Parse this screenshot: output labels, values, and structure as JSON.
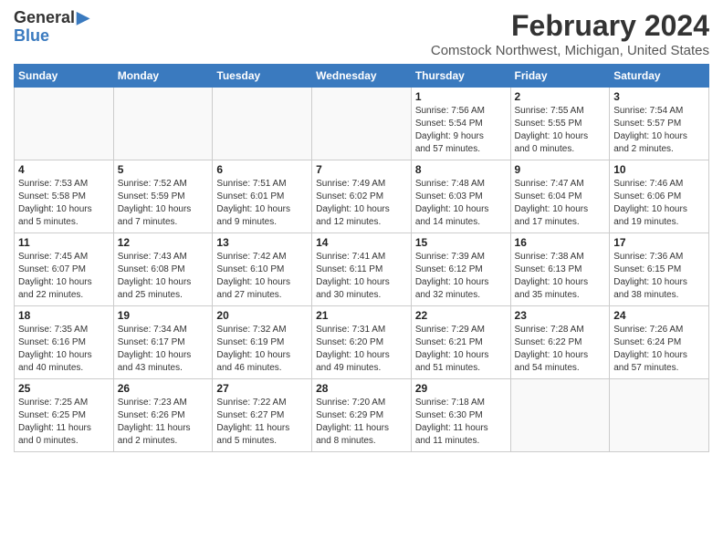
{
  "logo": {
    "general": "General",
    "blue": "Blue"
  },
  "title": "February 2024",
  "subtitle": "Comstock Northwest, Michigan, United States",
  "days_of_week": [
    "Sunday",
    "Monday",
    "Tuesday",
    "Wednesday",
    "Thursday",
    "Friday",
    "Saturday"
  ],
  "weeks": [
    [
      {
        "day": "",
        "info": ""
      },
      {
        "day": "",
        "info": ""
      },
      {
        "day": "",
        "info": ""
      },
      {
        "day": "",
        "info": ""
      },
      {
        "day": "1",
        "info": "Sunrise: 7:56 AM\nSunset: 5:54 PM\nDaylight: 9 hours\nand 57 minutes."
      },
      {
        "day": "2",
        "info": "Sunrise: 7:55 AM\nSunset: 5:55 PM\nDaylight: 10 hours\nand 0 minutes."
      },
      {
        "day": "3",
        "info": "Sunrise: 7:54 AM\nSunset: 5:57 PM\nDaylight: 10 hours\nand 2 minutes."
      }
    ],
    [
      {
        "day": "4",
        "info": "Sunrise: 7:53 AM\nSunset: 5:58 PM\nDaylight: 10 hours\nand 5 minutes."
      },
      {
        "day": "5",
        "info": "Sunrise: 7:52 AM\nSunset: 5:59 PM\nDaylight: 10 hours\nand 7 minutes."
      },
      {
        "day": "6",
        "info": "Sunrise: 7:51 AM\nSunset: 6:01 PM\nDaylight: 10 hours\nand 9 minutes."
      },
      {
        "day": "7",
        "info": "Sunrise: 7:49 AM\nSunset: 6:02 PM\nDaylight: 10 hours\nand 12 minutes."
      },
      {
        "day": "8",
        "info": "Sunrise: 7:48 AM\nSunset: 6:03 PM\nDaylight: 10 hours\nand 14 minutes."
      },
      {
        "day": "9",
        "info": "Sunrise: 7:47 AM\nSunset: 6:04 PM\nDaylight: 10 hours\nand 17 minutes."
      },
      {
        "day": "10",
        "info": "Sunrise: 7:46 AM\nSunset: 6:06 PM\nDaylight: 10 hours\nand 19 minutes."
      }
    ],
    [
      {
        "day": "11",
        "info": "Sunrise: 7:45 AM\nSunset: 6:07 PM\nDaylight: 10 hours\nand 22 minutes."
      },
      {
        "day": "12",
        "info": "Sunrise: 7:43 AM\nSunset: 6:08 PM\nDaylight: 10 hours\nand 25 minutes."
      },
      {
        "day": "13",
        "info": "Sunrise: 7:42 AM\nSunset: 6:10 PM\nDaylight: 10 hours\nand 27 minutes."
      },
      {
        "day": "14",
        "info": "Sunrise: 7:41 AM\nSunset: 6:11 PM\nDaylight: 10 hours\nand 30 minutes."
      },
      {
        "day": "15",
        "info": "Sunrise: 7:39 AM\nSunset: 6:12 PM\nDaylight: 10 hours\nand 32 minutes."
      },
      {
        "day": "16",
        "info": "Sunrise: 7:38 AM\nSunset: 6:13 PM\nDaylight: 10 hours\nand 35 minutes."
      },
      {
        "day": "17",
        "info": "Sunrise: 7:36 AM\nSunset: 6:15 PM\nDaylight: 10 hours\nand 38 minutes."
      }
    ],
    [
      {
        "day": "18",
        "info": "Sunrise: 7:35 AM\nSunset: 6:16 PM\nDaylight: 10 hours\nand 40 minutes."
      },
      {
        "day": "19",
        "info": "Sunrise: 7:34 AM\nSunset: 6:17 PM\nDaylight: 10 hours\nand 43 minutes."
      },
      {
        "day": "20",
        "info": "Sunrise: 7:32 AM\nSunset: 6:19 PM\nDaylight: 10 hours\nand 46 minutes."
      },
      {
        "day": "21",
        "info": "Sunrise: 7:31 AM\nSunset: 6:20 PM\nDaylight: 10 hours\nand 49 minutes."
      },
      {
        "day": "22",
        "info": "Sunrise: 7:29 AM\nSunset: 6:21 PM\nDaylight: 10 hours\nand 51 minutes."
      },
      {
        "day": "23",
        "info": "Sunrise: 7:28 AM\nSunset: 6:22 PM\nDaylight: 10 hours\nand 54 minutes."
      },
      {
        "day": "24",
        "info": "Sunrise: 7:26 AM\nSunset: 6:24 PM\nDaylight: 10 hours\nand 57 minutes."
      }
    ],
    [
      {
        "day": "25",
        "info": "Sunrise: 7:25 AM\nSunset: 6:25 PM\nDaylight: 11 hours\nand 0 minutes."
      },
      {
        "day": "26",
        "info": "Sunrise: 7:23 AM\nSunset: 6:26 PM\nDaylight: 11 hours\nand 2 minutes."
      },
      {
        "day": "27",
        "info": "Sunrise: 7:22 AM\nSunset: 6:27 PM\nDaylight: 11 hours\nand 5 minutes."
      },
      {
        "day": "28",
        "info": "Sunrise: 7:20 AM\nSunset: 6:29 PM\nDaylight: 11 hours\nand 8 minutes."
      },
      {
        "day": "29",
        "info": "Sunrise: 7:18 AM\nSunset: 6:30 PM\nDaylight: 11 hours\nand 11 minutes."
      },
      {
        "day": "",
        "info": ""
      },
      {
        "day": "",
        "info": ""
      }
    ]
  ]
}
